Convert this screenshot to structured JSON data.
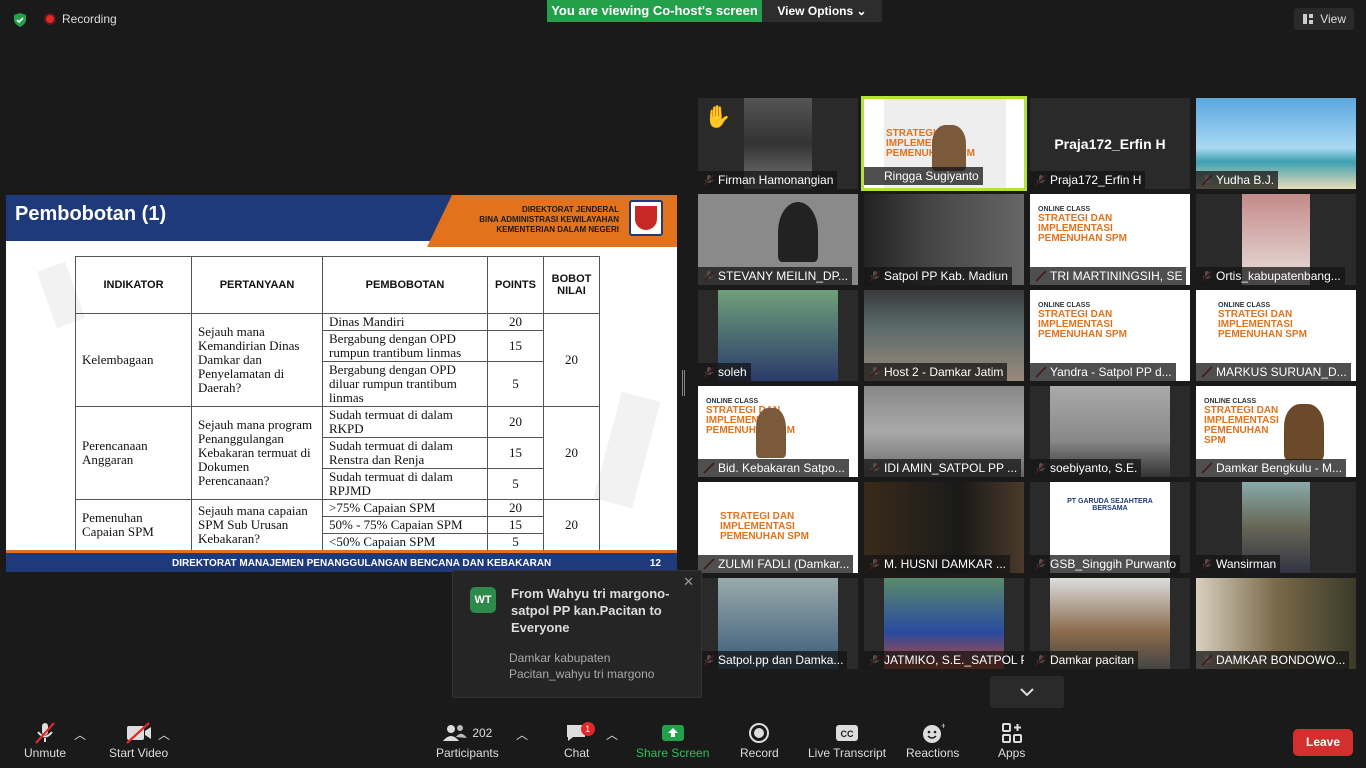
{
  "topbar": {
    "recording_label": "Recording",
    "viewing_banner": "You are viewing Co-host's screen",
    "view_options": "View Options",
    "view_label": "View"
  },
  "slide": {
    "title": "Pembobotan (1)",
    "dirjen_line1": "DIREKTORAT JENDERAL",
    "dirjen_line2": "BINA ADMINISTRASI KEWILAYAHAN",
    "dirjen_line3": "KEMENTERIAN DALAM NEGERI",
    "headers": {
      "indikator": "INDIKATOR",
      "pertanyaan": "PERTANYAAN",
      "pembobotan": "PEMBOBOTAN",
      "points": "POINTS",
      "bobot_nilai": "BOBOT NILAI"
    },
    "rows": {
      "kelembagaan": "Kelembagaan",
      "q1": "Sejauh mana Kemandirian Dinas Damkar dan Penyelamatan di Daerah?",
      "o1a": "Dinas Mandiri",
      "p1a": "20",
      "o1b": "Bergabung dengan OPD rumpun trantibum linmas",
      "p1b": "15",
      "o1c": "Bergabung dengan OPD diluar rumpun trantibum linmas",
      "p1c": "5",
      "n1": "20",
      "perencanaan": "Perencanaan Anggaran",
      "q2": "Sejauh mana program Penanggulangan Kebakaran termuat di Dokumen Perencanaan?",
      "o2a": "Sudah termuat di dalam RKPD",
      "p2a": "20",
      "o2b": "Sudah termuat di dalam Renstra dan Renja",
      "p2b": "15",
      "o2c": "Sudah termuat di dalam RPJMD",
      "p2c": "5",
      "n2": "20",
      "pemenuhan": "Pemenuhan Capaian SPM",
      "q3": "Sejauh mana capaian SPM Sub Urusan Kebakaran?",
      "o3a": ">75% Capaian SPM",
      "p3a": "20",
      "o3b": "50% - 75% Capaian SPM",
      "p3b": "15",
      "o3c": "<50% Capaian SPM",
      "p3c": "5",
      "n3": "20"
    },
    "footer": "DIREKTORAT MANAJEMEN PENANGGULANGAN BENCANA DAN KEBAKARAN",
    "page": "12"
  },
  "gallery": {
    "t1": "Firman Hamonangian",
    "t2": "Ringga Sugiyanto",
    "t3": "Praja172_Erfin H",
    "t3_big": "Praja172_Erfin H",
    "t4": "Yudha B.J.",
    "t5": "STEVANY MEILIN_DP...",
    "t6": "Satpol PP Kab. Madiun",
    "t7": "TRI MARTININGSIH, SE",
    "t8": "Ortis_kabupatenbang...",
    "t9": "soleh",
    "t10": "Host 2 - Damkar Jatim",
    "t11": "Yandra - Satpol PP d...",
    "t12": "MARKUS SURUAN_D...",
    "t13": "Bid. Kebakaran Satpo...",
    "t14": "IDI AMIN_SATPOL PP ...",
    "t15": "soebiyanto, S.E.",
    "t16": "Damkar Bengkulu - M...",
    "t17": "ZULMI FADLI (Damkar...",
    "t18": "M. HUSNI DAMKAR  ...",
    "t19": "GSB_Singgih Purwanto",
    "t19_company": "PT GARUDA SEJAHTERA BERSAMA",
    "t20": "Wansirman",
    "t21": "Satpol.pp dan Damka...",
    "t22": "JATMIKO, S.E._SATPOL P...",
    "t23": "Damkar pacitan",
    "t24": "DAMKAR BONDOWO...",
    "thumb_small": "ONLINE CLASS",
    "thumb_big": "STRATEGI DAN IMPLEMENTASI PEMENUHAN SPM"
  },
  "chat_popup": {
    "avatar": "WT",
    "from": "From Wahyu tri margono-satpol PP kan.Pacitan to Everyone",
    "message": "Damkar kabupaten Pacitan_wahyu tri margono"
  },
  "toolbar": {
    "unmute": "Unmute",
    "start_video": "Start Video",
    "participants": "Participants",
    "participants_count": "202",
    "chat": "Chat",
    "chat_badge": "1",
    "share_screen": "Share Screen",
    "record": "Record",
    "live_transcript": "Live Transcript",
    "reactions": "Reactions",
    "apps": "Apps",
    "leave": "Leave"
  },
  "colors": {
    "green": "#23a04a",
    "leave_red": "#d32f2f",
    "active_border": "#b5e23a",
    "slide_blue": "#1e3a7a",
    "slide_orange": "#e2731c"
  }
}
